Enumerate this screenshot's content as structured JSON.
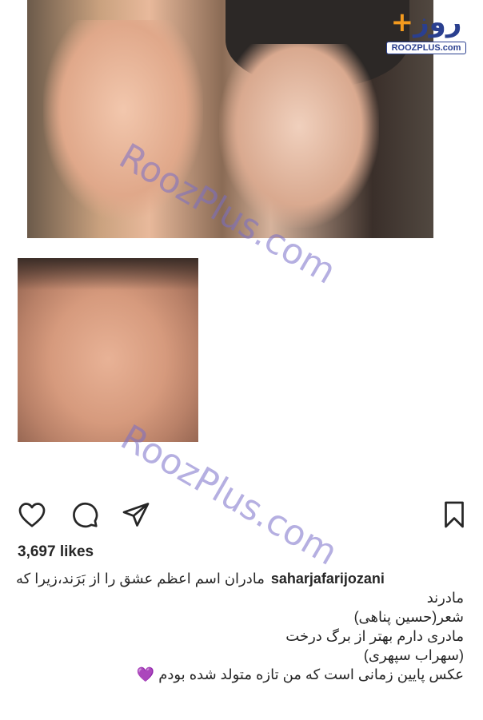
{
  "logo": {
    "mark_text": "روز",
    "plus": "+",
    "url": "ROOZPLUS.com"
  },
  "watermark": {
    "text": "RoozPlus.com"
  },
  "post": {
    "likes": "3,697 likes",
    "username": "saharjafarijozani",
    "caption_line1": "مادران اسم اعظم عشق را از بَرَند،زیرا که",
    "caption_line2": "مادرند",
    "caption_line3": "شعر(حسین پناهی)",
    "caption_line4": "مادری دارم بهتر از برگ درخت",
    "caption_line5": "(سهراب سپهری)",
    "caption_line6": "عکس پایین زمانی است که من تازه متولد شده بودم",
    "caption_emoji": "💜"
  },
  "icons": {
    "like": "heart-icon",
    "comment": "comment-icon",
    "share": "share-icon",
    "save": "bookmark-icon"
  },
  "colors": {
    "watermark": "#786ec8",
    "logo_blue": "#2a3f8f",
    "logo_orange": "#f39a1e",
    "text": "#262626"
  }
}
